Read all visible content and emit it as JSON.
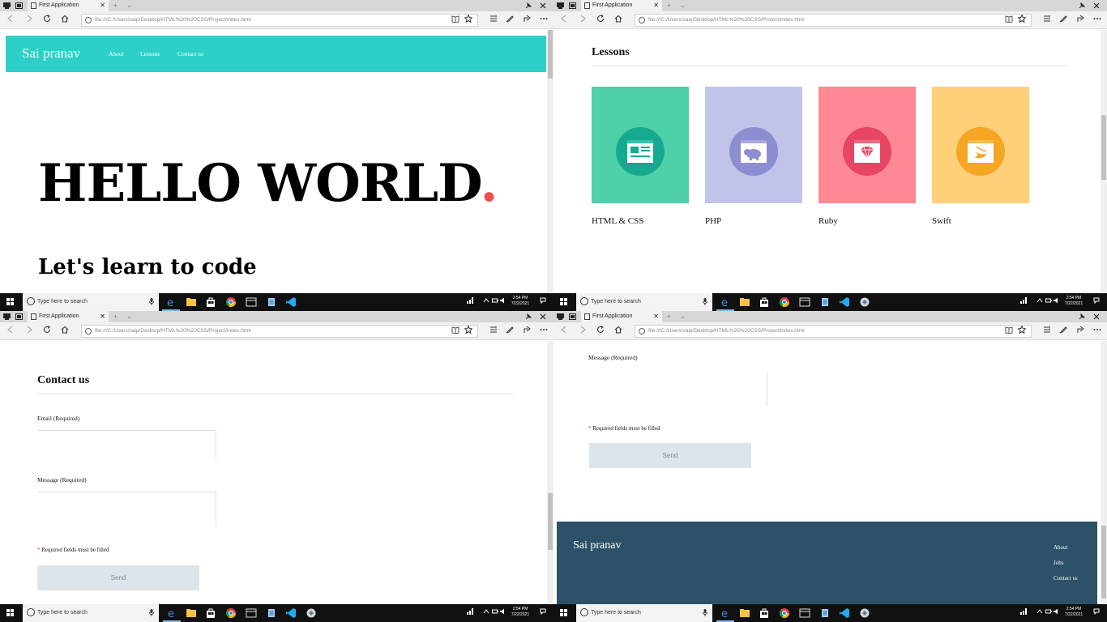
{
  "browser": {
    "tab_title": "First Application",
    "close_glyph": "✕",
    "new_tab_glyph": "+",
    "chevron_glyph": "⌄",
    "url": "file:///C:/Users/saip/Desktop/HTML%20%20CSS/Project/index.html",
    "icons": [
      "back-icon",
      "forward-icon",
      "refresh-icon",
      "home-icon",
      "reading-view-icon",
      "favorite-star-icon",
      "hub-icon",
      "notes-icon",
      "share-icon",
      "more-icon"
    ]
  },
  "taskbar": {
    "search_placeholder": "Type here to search",
    "time": "2:54 PM",
    "date": "7/22/2021",
    "apps": [
      "edge-icon",
      "file-explorer-icon",
      "store-icon",
      "chrome-icon",
      "media-icon",
      "notepad-icon",
      "vscode-icon",
      "app-icon"
    ],
    "tray_icons": [
      "network-icon",
      "chevron-up-icon",
      "volume-icon",
      "notifications-icon"
    ]
  },
  "site": {
    "brand": "Sai pranav",
    "nav": [
      "About",
      "Lessons",
      "Contact us"
    ],
    "hero": {
      "title": "HELLO WORLD",
      "dot": ".",
      "subtitle": "Let's learn to code"
    },
    "lessons": {
      "title": "Lessons",
      "cards": [
        {
          "label": "HTML & CSS",
          "bg": "#4ed0a8",
          "circle": "#17a990",
          "icon": "html-css-icon"
        },
        {
          "label": "PHP",
          "bg": "#c1c3e9",
          "circle": "#8d8dd1",
          "icon": "php-elephant-icon"
        },
        {
          "label": "Ruby",
          "bg": "#ff8895",
          "circle": "#e64663",
          "icon": "ruby-gem-icon"
        },
        {
          "label": "Swift",
          "bg": "#ffcf7a",
          "circle": "#f5a623",
          "icon": "swift-icon"
        }
      ]
    },
    "contact": {
      "title": "Contact us",
      "email_label": "Email (Required)",
      "message_label": "Message (Required)",
      "required_note": "Required fields must be filled",
      "required_star": "*",
      "send_label": "Send"
    },
    "footer": {
      "brand": "Sai pranav",
      "links": [
        "About",
        "Jobs",
        "Contact us"
      ]
    }
  },
  "colors": {
    "header_teal": "#2dd0c6",
    "hero_dot": "#f24b50",
    "footer_bg": "#2c5168",
    "send_bg": "#dde5ea"
  }
}
